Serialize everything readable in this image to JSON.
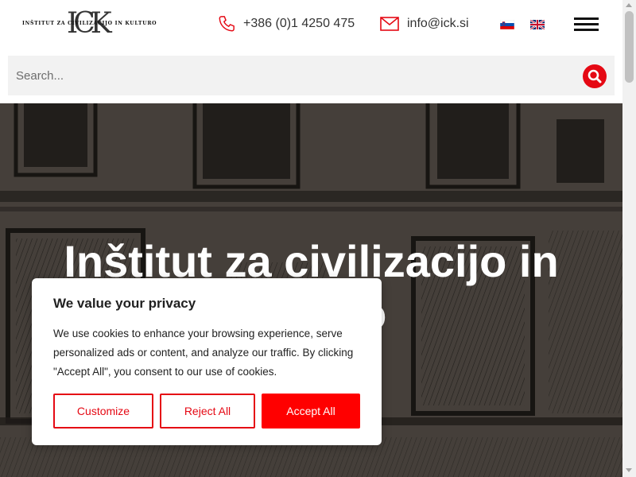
{
  "header": {
    "logo_text": "INŠTITUT ZA CIVILIZACIJO IN KULTURO",
    "logo_mark": "ICK",
    "phone": "+386 (0)1 4250 475",
    "email": "info@ick.si",
    "languages": [
      "sl",
      "en"
    ],
    "icons": [
      "phone-icon",
      "mail-icon",
      "flag-si-icon",
      "flag-uk-icon",
      "hamburger-menu-icon"
    ]
  },
  "search": {
    "placeholder": "Search...",
    "icon": "search-icon"
  },
  "hero": {
    "title": "Inštitut za civilizacijo in kulturo"
  },
  "cookie": {
    "title": "We value your privacy",
    "text": "We use cookies to enhance your browsing experience, serve personalized ads or content, and analyze our traffic. By clicking \"Accept All\", you consent to our use of cookies.",
    "customize_label": "Customize",
    "reject_label": "Reject All",
    "accept_label": "Accept All"
  },
  "colors": {
    "accent": "#e50914",
    "accept": "#ff0000",
    "text": "#212121"
  }
}
